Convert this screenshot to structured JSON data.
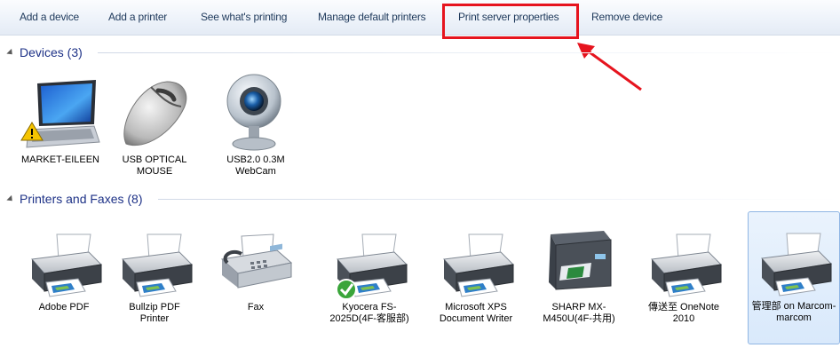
{
  "toolbar": {
    "buttons": [
      "Add a device",
      "Add a printer",
      "See what's printing",
      "Manage default printers",
      "Print server properties",
      "Remove device"
    ]
  },
  "sections": {
    "devices": {
      "title": "Devices (3)",
      "items": [
        {
          "label": "MARKET-EILEEN",
          "icon": "laptop-warning-icon"
        },
        {
          "label": "USB OPTICAL MOUSE",
          "icon": "mouse-icon"
        },
        {
          "label": "USB2.0 0.3M WebCam",
          "icon": "webcam-icon"
        }
      ]
    },
    "printers": {
      "title": "Printers and Faxes (8)",
      "items": [
        {
          "label": "Adobe PDF",
          "icon": "printer-icon"
        },
        {
          "label": "Bullzip PDF Printer",
          "icon": "printer-icon"
        },
        {
          "label": "Fax",
          "icon": "fax-icon"
        },
        {
          "label": "Kyocera FS-2025D(4F-客服部)",
          "icon": "printer-default-icon"
        },
        {
          "label": "Microsoft XPS Document Writer",
          "icon": "printer-icon"
        },
        {
          "label": "SHARP MX-M450U(4F-共用)",
          "icon": "multifunction-printer-icon"
        },
        {
          "label": "傳送至 OneNote 2010",
          "icon": "printer-icon"
        },
        {
          "label": "管理部 on Marcom-marcom",
          "icon": "printer-icon"
        }
      ]
    }
  },
  "colors": {
    "highlight": "#e6141e",
    "section_title": "#1e3287",
    "toolbar_text": "#1e395b",
    "selection": "#d9e9fb"
  }
}
